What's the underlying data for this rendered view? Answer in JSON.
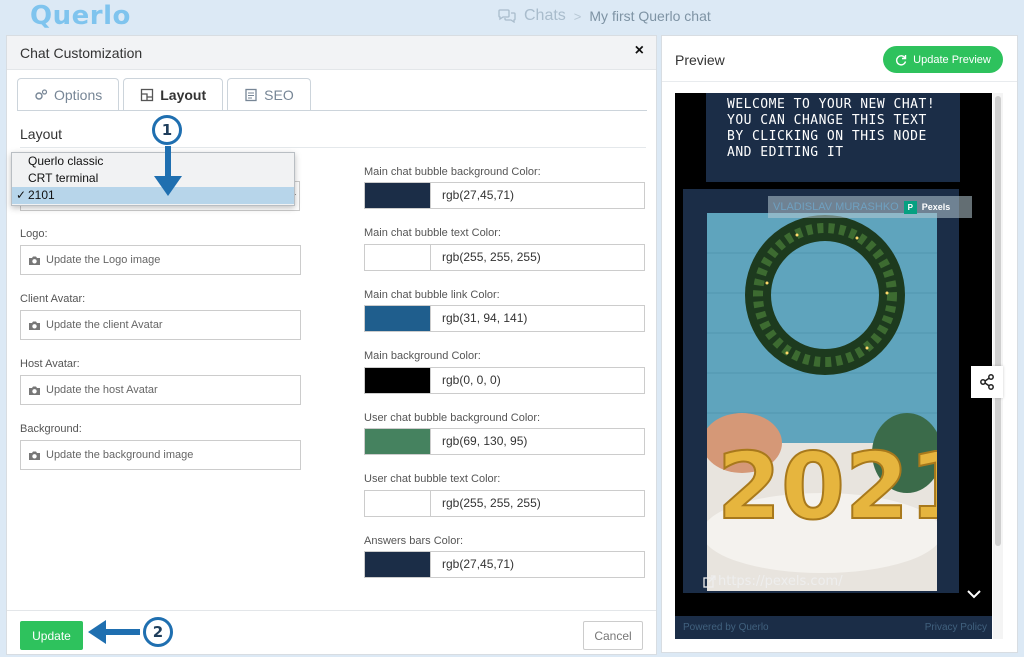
{
  "app": {
    "logo": "Querlo",
    "breadcrumb": {
      "chats": "Chats",
      "current": "My first Querlo chat"
    }
  },
  "modal": {
    "title": "Chat Customization",
    "close": "×",
    "tabs": [
      {
        "label": "Options",
        "icon": "gears-icon"
      },
      {
        "label": "Layout",
        "icon": "layout-icon",
        "active": true
      },
      {
        "label": "SEO",
        "icon": "document-icon"
      }
    ],
    "section_title": "Layout",
    "layout_select": {
      "options": [
        "Querlo classic",
        "CRT terminal",
        "2101"
      ],
      "selected": "2101",
      "check": "✓"
    },
    "uploads": [
      {
        "label": "Logo:",
        "button": "Update the Logo image"
      },
      {
        "label": "Client Avatar:",
        "button": "Update the client Avatar"
      },
      {
        "label": "Host Avatar:",
        "button": "Update the host Avatar"
      },
      {
        "label": "Background:",
        "button": "Update the background image"
      }
    ],
    "colors": [
      {
        "label": "Main chat bubble background Color:",
        "value": "rgb(27,45,71)",
        "hex": "#1b2d47"
      },
      {
        "label": "Main chat bubble text Color:",
        "value": "rgb(255, 255, 255)",
        "hex": "#ffffff"
      },
      {
        "label": "Main chat bubble link Color:",
        "value": "rgb(31, 94, 141)",
        "hex": "#1f5e8d"
      },
      {
        "label": "Main background Color:",
        "value": "rgb(0, 0, 0)",
        "hex": "#000000"
      },
      {
        "label": "User chat bubble background Color:",
        "value": "rgb(69, 130, 95)",
        "hex": "#45825f"
      },
      {
        "label": "User chat bubble text Color:",
        "value": "rgb(255, 255, 255)",
        "hex": "#ffffff"
      },
      {
        "label": "Answers bars Color:",
        "value": "rgb(27,45,71)",
        "hex": "#1b2d47"
      }
    ],
    "update_button": "Update",
    "cancel_button": "Cancel"
  },
  "annotations": {
    "step1": "1",
    "step2": "2"
  },
  "preview": {
    "title": "Preview",
    "update_button": "Update Preview",
    "node_text": "WELCOME TO YOUR NEW CHAT! YOU CAN CHANGE THIS TEXT BY CLICKING ON THIS NODE AND EDITING IT",
    "photo_credit": "VLADISLAV MURASHKO",
    "pexels_badge": "P",
    "pexels_label": "Pexels",
    "image_link": "https://pexels.com/",
    "balloon_text": "2021",
    "powered_by": "Powered by Querlo",
    "privacy": "Privacy Policy"
  },
  "colors": {
    "accent_green": "#2ec25d",
    "annotation_blue": "#1f6fb0",
    "logo_blue": "#7fc4ee"
  }
}
